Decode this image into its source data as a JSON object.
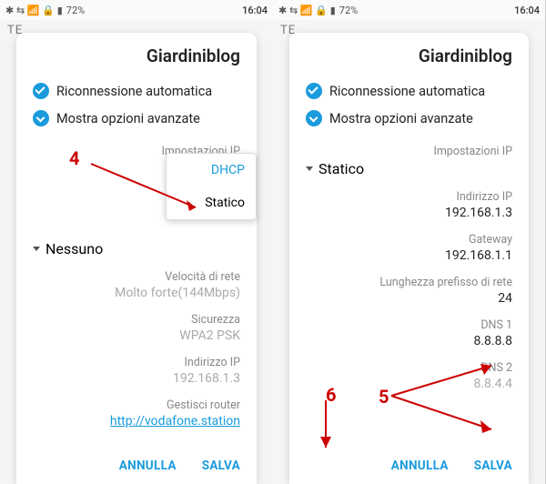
{
  "statusbar": {
    "time": "16:04",
    "battery_pct": "72%",
    "icons": "✱ ⇆ 📶 🔒 ▮"
  },
  "bg_tab": "TE",
  "wifi_name": "Giardiniblog",
  "checks": {
    "auto_reconnect": "Riconnessione automatica",
    "show_advanced": "Mostra opzioni avanzate"
  },
  "labels": {
    "ip_settings": "Impostazioni IP",
    "dhcp": "DHCP",
    "static": "Statico",
    "none": "Nessuno",
    "speed": "Velocità di rete",
    "speed_val": "Molto forte(144Mbps)",
    "security": "Sicurezza",
    "security_val": "WPA2 PSK",
    "ip_addr": "Indirizzo IP",
    "ip_val": "192.168.1.3",
    "manage_router": "Gestisci router",
    "router_url": "http://vodafone.station",
    "gateway": "Gateway",
    "gateway_val": "192.168.1.1",
    "prefix_len": "Lunghezza prefisso di rete",
    "prefix_val": "24",
    "dns1": "DNS 1",
    "dns1_val": "8.8.8.8",
    "dns2": "DNS 2",
    "dns2_val": "8.8.4.4"
  },
  "buttons": {
    "cancel": "ANNULLA",
    "save": "SALVA"
  },
  "annotations": {
    "n4": "4",
    "n5": "5",
    "n6": "6"
  }
}
